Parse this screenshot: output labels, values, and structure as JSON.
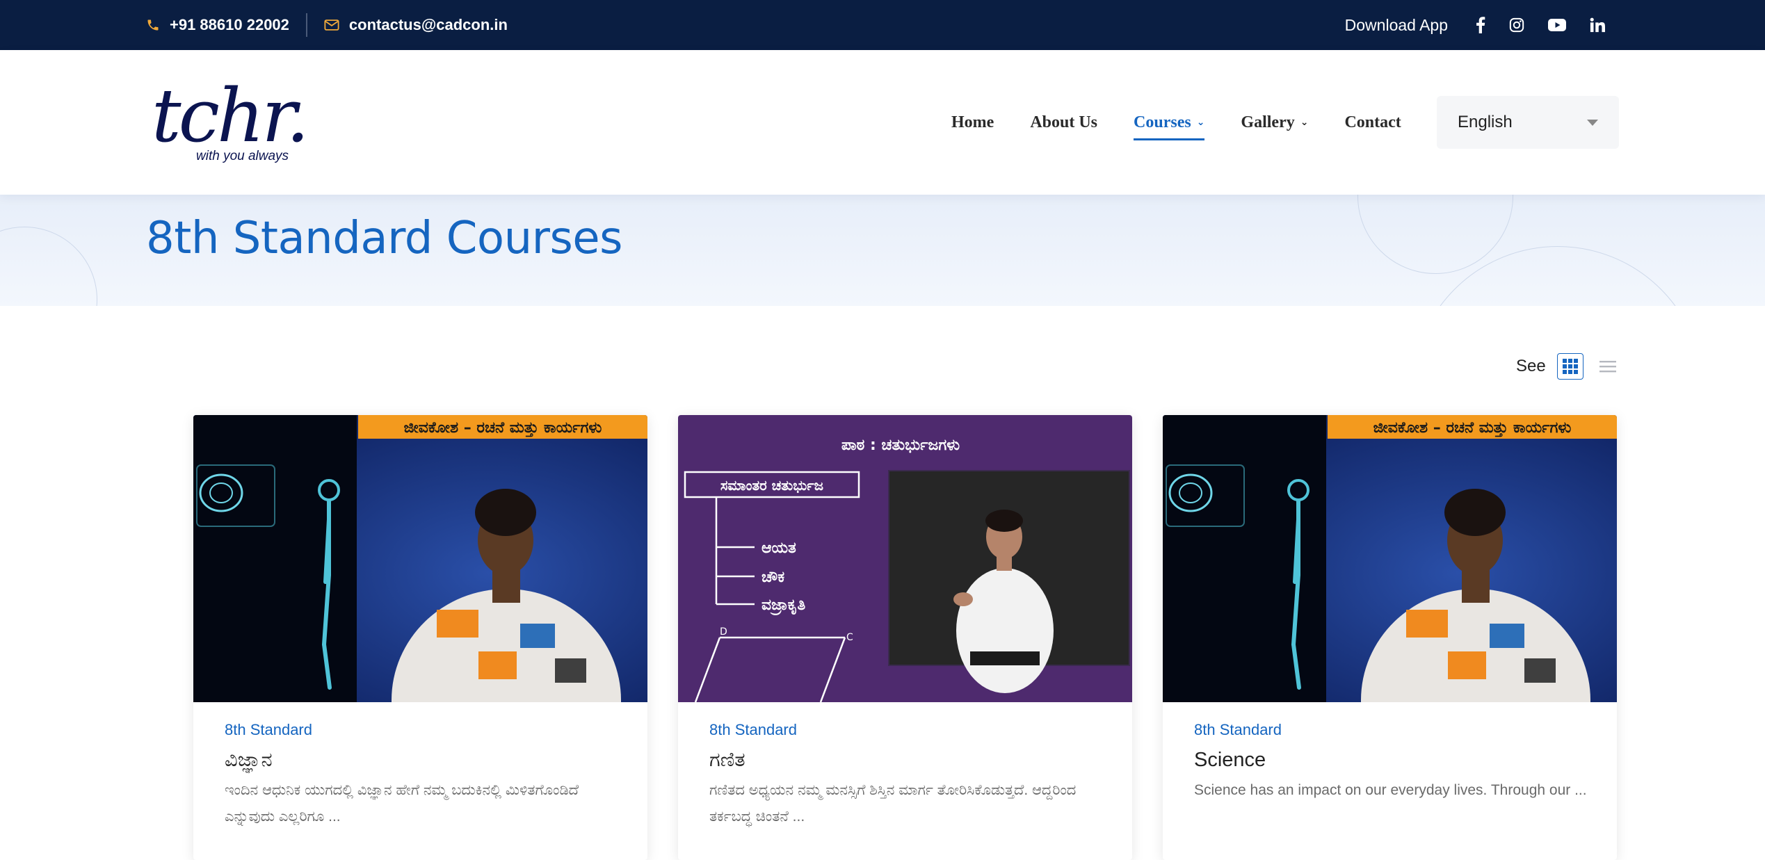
{
  "topbar": {
    "phone": "+91 88610 22002",
    "email": "contactus@cadcon.in",
    "download_app": "Download App",
    "social": [
      "facebook-icon",
      "instagram-icon",
      "youtube-icon",
      "linkedin-icon"
    ]
  },
  "logo": {
    "word": "tchr.",
    "tagline": "with you always"
  },
  "nav": {
    "items": [
      {
        "label": "Home"
      },
      {
        "label": "About Us"
      },
      {
        "label": "Courses"
      },
      {
        "label": "Gallery"
      },
      {
        "label": "Contact"
      }
    ],
    "active": "Courses",
    "language": "English"
  },
  "hero": {
    "title": "8th Standard Courses"
  },
  "view": {
    "label": "See",
    "active_mode": "grid"
  },
  "cards": [
    {
      "category": "8th Standard",
      "title": "ವಿಜ್ಞಾನ",
      "description": "ಇಂದಿನ ಆಧುನಿಕ ಯುಗದಲ್ಲಿ ವಿಜ್ಞಾನ ಹೇಗೆ ನಮ್ಮ ಬದುಕಿನಲ್ಲಿ ಮಿಳಿತಗೊಂಡಿದೆ ಎನ್ನುವುದು ಎಲ್ಲರಿಗೂ ...",
      "banner": "ಜೀವಕೋಶ – ರಚನೆ ಮತ್ತು ಕಾರ್ಯಗಳು"
    },
    {
      "category": "8th Standard",
      "title": "ಗಣಿತ",
      "description": "ಗಣಿತದ ಅಧ್ಯಯನ ನಮ್ಮ ಮನಸ್ಸಿಗೆ ಶಿಸ್ತಿನ ಮಾರ್ಗ ತೋರಿಸಿಕೊಡುತ್ತದೆ. ಆದ್ದರಿಂದ ತರ್ಕಬದ್ಧ ಚಿಂತನೆ ...",
      "lesson": "ಪಾಠ : ಚತುರ್ಭುಜಗಳು",
      "box_label": "ಸಮಾಂತರ ಚತುರ್ಭುಜ",
      "tree": [
        "ಆಯತ",
        "ಚೌಕ",
        "ವಜ್ರಾಕೃತಿ"
      ],
      "vertex_d": "D",
      "vertex_c": "C"
    },
    {
      "category": "8th Standard",
      "title": "Science",
      "description": "Science has an impact on our everyday lives. Through our ...",
      "banner": "ಜೀವಕೋಶ – ರಚನೆ ಮತ್ತು ಕಾರ್ಯಗಳು"
    }
  ],
  "colors": {
    "topbar_bg": "#0a1e42",
    "accent": "#1565c0",
    "icon_accent": "#f0a93a",
    "banner_orange": "#f39a1e",
    "math_bg": "#4e2a6e"
  }
}
